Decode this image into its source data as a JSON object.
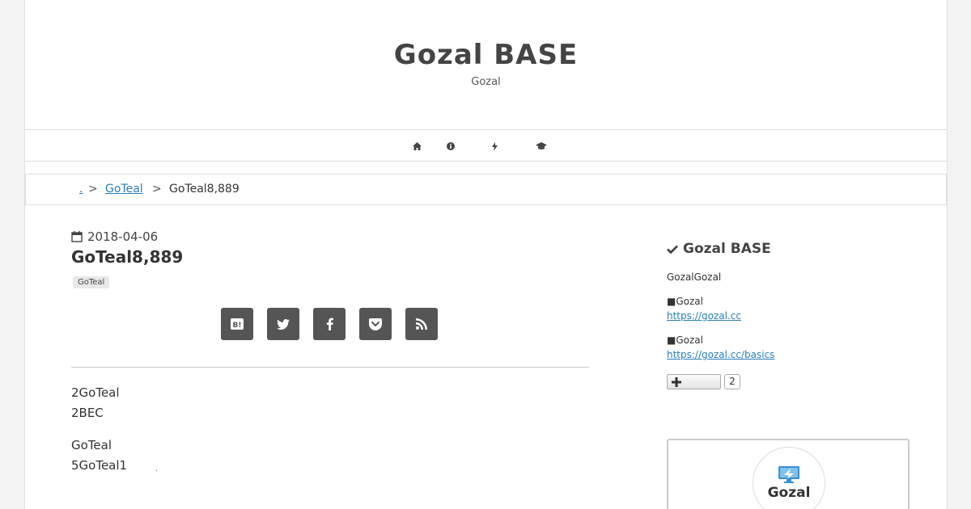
{
  "header": {
    "title": "Gozal BASE",
    "description": "Gozal"
  },
  "nav": {
    "items": [
      {
        "icon": "home-icon"
      },
      {
        "icon": "info-icon"
      },
      {
        "icon": "bolt-icon"
      },
      {
        "icon": "graduation-cap-icon"
      }
    ]
  },
  "breadcrumb": {
    "home_label": ".",
    "separator": ">",
    "category": "GoTeal",
    "current": "GoTeal8,889"
  },
  "post": {
    "date": "2018-04-06",
    "title": "GoTeal8,889",
    "category_tag": "GoTeal",
    "share_buttons": [
      {
        "icon": "hatena-bookmark-icon",
        "label": "B!"
      },
      {
        "icon": "twitter-icon"
      },
      {
        "icon": "facebook-icon"
      },
      {
        "icon": "pocket-icon"
      },
      {
        "icon": "rss-icon"
      }
    ],
    "paragraph1_line1": "2GoTeal",
    "paragraph1_line2": "2BEC",
    "paragraph2_line1": "GoTeal",
    "paragraph2_line2": "5GoTeal1",
    "inline_link": "."
  },
  "sidebar": {
    "widget_title": "Gozal BASE",
    "intro": "GozalGozal",
    "item1_label": "■Gozal",
    "item1_link": "https://gozal.cc",
    "item2_label": "■Gozal",
    "item2_link": "https://gozal.cc/basics",
    "follow_count": "2",
    "profile_logo_text": "Gozal"
  },
  "colors": {
    "link": "#2a7fb8",
    "share_button": "#555555",
    "title": "#444444"
  }
}
